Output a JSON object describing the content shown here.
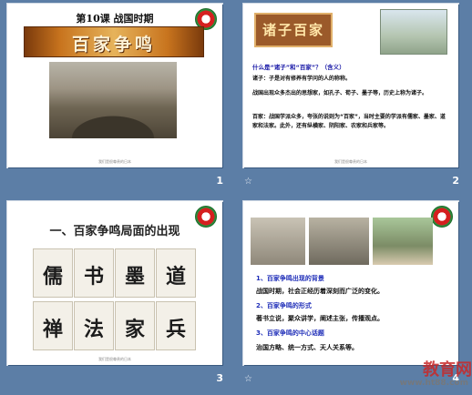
{
  "slides": [
    {
      "number": "1",
      "title": "第10课 战国时期",
      "banner": "百家争鸣",
      "footer": "我们是很尊贵的日本"
    },
    {
      "number": "2",
      "banner": "诸子百家",
      "question": "什么是“诸子”和“百家”？（含义）",
      "p1": "诸子：子是对有修养有学问的人的称称。",
      "p2": "战国出现众多杰出的思想家，如孔子、荀子、墨子等，历史上称为诸子。",
      "p3": "百家：战国学派众多，夸张的说则为“百家”，当时主要的学派有儒家、墨家、道家和法家。此外，还有纵横家、阴阳家、农家和兵家等。",
      "footer": "我们是很尊贵的日本"
    },
    {
      "number": "3",
      "title": "一、百家争鸣局面的出现",
      "tiles": [
        "儒",
        "书",
        "墨",
        "道",
        "禅",
        "法",
        "家",
        "兵"
      ],
      "footer": "我们是很尊贵的日本"
    },
    {
      "number": "4",
      "h1": "1、百家争鸣出现的背景",
      "b1": "战国时期，社会正经历着深刻而广泛的变化。",
      "h2": "2、百家争鸣的形式",
      "b2": "著书立说，聚众讲学，阐述主张，传播观点。",
      "h3": "3、百家争鸣的中心话题",
      "b3": "治国方略、统一方式、天人关系等。",
      "watermark": "教育网",
      "watermark_url": "www.ht88.com"
    }
  ],
  "colors": {
    "background": "#5c7ea6",
    "blue_heading": "#1e2db8",
    "question_blue": "#1a1aa8"
  }
}
